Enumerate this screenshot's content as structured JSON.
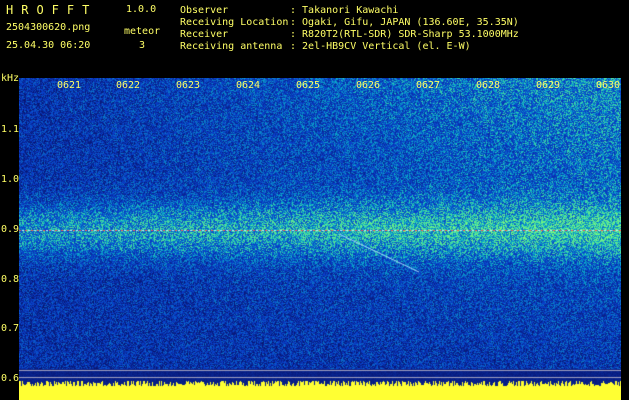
{
  "app": {
    "name": "HROFFT",
    "version": "1.0.0"
  },
  "file": {
    "name": "2504300620.png",
    "datetime": "25.04.30 06:20"
  },
  "meteor": {
    "label": "meteor",
    "count": "3"
  },
  "info": [
    {
      "key": "Observer",
      "value": ": Takanori Kawachi"
    },
    {
      "key": "Receiving Location",
      "value": ": Ogaki, Gifu, JAPAN (136.60E, 35.35N)"
    },
    {
      "key": "Receiver",
      "value": ": R820T2(RTL-SDR) SDR-Sharp 53.1000MHz"
    },
    {
      "key": "Receiving antenna",
      "value": ": 2el-HB9CV Vertical (el. E-W)"
    }
  ],
  "axis": {
    "y_unit": "kHz",
    "y_ticks": [
      "1.1",
      "1.0",
      "0.9",
      "0.8",
      "0.7",
      "0.6"
    ],
    "x_ticks": [
      "0621",
      "0622",
      "0623",
      "0624",
      "0625",
      "0626",
      "0627",
      "0628",
      "0629",
      "0630"
    ]
  },
  "colors": {
    "text": "#ffff66",
    "background": "#000000",
    "spectrum_low": "#0a1a8c",
    "spectrum_high": "#32e6d2",
    "signal": "#ff5050"
  }
}
